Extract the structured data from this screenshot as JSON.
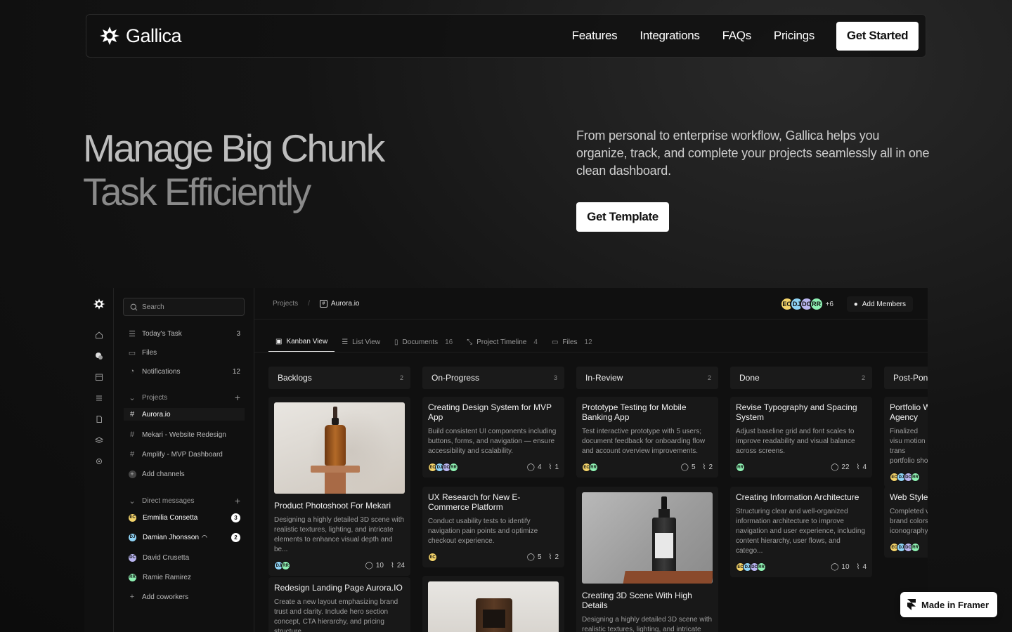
{
  "brand": {
    "name": "Gallica"
  },
  "nav": {
    "links": [
      "Features",
      "Integrations",
      "FAQs",
      "Pricings"
    ],
    "cta": "Get Started"
  },
  "hero": {
    "title_line1": "Manage Big Chunk",
    "title_line2": "Task Efficiently",
    "description": "From personal to enterprise workflow, Gallica helps you organize, track, and complete your projects seamlessly all in one clean dashboard.",
    "cta": "Get Template"
  },
  "app": {
    "search_placeholder": "Search",
    "sidebar": {
      "todays_task": {
        "label": "Today's Task",
        "count": "3"
      },
      "files": {
        "label": "Files"
      },
      "notifications": {
        "label": "Notifications",
        "count": "12"
      },
      "projects_header": "Projects",
      "projects": [
        "Aurora.io",
        "Mekari - Website Redesign",
        "Amplify - MVP Dashboard"
      ],
      "add_channels": "Add channels",
      "dm_header": "Direct messages",
      "dms": [
        {
          "initials": "EC",
          "name": "Emmilia Consetta",
          "badge": "3",
          "color": "#f3d36a"
        },
        {
          "initials": "DJ",
          "name": "Damian Jhonsson",
          "badge": "2",
          "color": "#8fd3f5"
        },
        {
          "initials": "DC",
          "name": "David Crusetta",
          "badge": "",
          "color": "#b9b5f0"
        },
        {
          "initials": "RR",
          "name": "Ramie Ramirez",
          "badge": "",
          "color": "#8ef0b2"
        }
      ],
      "add_coworkers": "Add coworkers"
    },
    "breadcrumb": {
      "root": "Projects",
      "current": "Aurora.io"
    },
    "members": {
      "initials": [
        "EC",
        "DJ",
        "DC",
        "RR"
      ],
      "more": "+6",
      "add_label": "Add Members"
    },
    "tabs": [
      {
        "label": "Kanban View",
        "count": ""
      },
      {
        "label": "List View",
        "count": ""
      },
      {
        "label": "Documents",
        "count": "16"
      },
      {
        "label": "Project Timeline",
        "count": "4"
      },
      {
        "label": "Files",
        "count": "12"
      }
    ],
    "columns": [
      {
        "name": "Backlogs",
        "count": "2"
      },
      {
        "name": "On-Progress",
        "count": "3"
      },
      {
        "name": "In-Review",
        "count": "2"
      },
      {
        "name": "Done",
        "count": "2"
      },
      {
        "name": "Post-Pone",
        "count": ""
      }
    ],
    "cards": {
      "backlog_1": {
        "title": "Product Photoshoot For Mekari",
        "desc": "Designing a highly detailed 3D scene with realistic textures, lighting, and intricate elements to enhance visual depth and be...",
        "comments": "10",
        "attachments": "24"
      },
      "backlog_2": {
        "title": "Redesign Landing Page Aurora.IO",
        "desc": "Create a new layout emphasizing brand trust and clarity. Include hero section concept, CTA hierarchy, and pricing structure."
      },
      "progress_1": {
        "title": "Creating Design System for MVP App",
        "desc": "Build consistent UI components including buttons, forms, and navigation — ensure accessibility and scalability.",
        "comments": "4",
        "attachments": "1"
      },
      "progress_2": {
        "title": "UX Research for New E-Commerce Platform",
        "desc": "Conduct usability tests to identify navigation pain points and optimize checkout experience.",
        "comments": "5",
        "attachments": "2"
      },
      "review_1": {
        "title": "Prototype Testing for Mobile Banking App",
        "desc": "Test interactive prototype with 5 users; document feedback for onboarding flow and account overview improvements.",
        "comments": "5",
        "attachments": "2"
      },
      "review_2": {
        "title": "Creating 3D Scene With High Details",
        "desc": "Designing a highly detailed 3D scene with realistic textures, lighting, and intricate"
      },
      "done_1": {
        "title": "Revise Typography and Spacing System",
        "desc": "Adjust baseline grid and font scales to improve readability and visual balance across screens.",
        "comments": "22",
        "attachments": "4"
      },
      "done_2": {
        "title": "Creating Information Architecture",
        "desc": "Structuring clear and well-organized information architecture to improve navigation and user experience, including content hierarchy, user flows, and catego...",
        "comments": "10",
        "attachments": "4"
      },
      "post_1": {
        "title": "Portfolio W Agency",
        "desc": "Finalized visu motion trans portfolio sho"
      },
      "post_2": {
        "title": "Web Style",
        "desc": "Completed v brand colors iconography"
      }
    }
  },
  "framer_badge": "Made in Framer"
}
